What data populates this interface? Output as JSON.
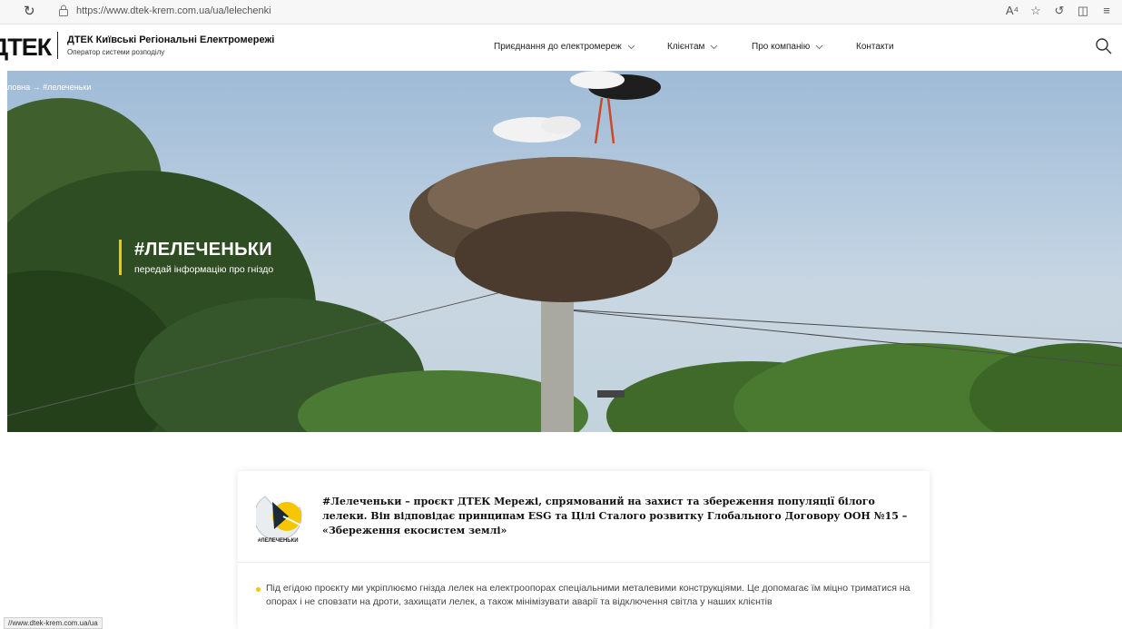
{
  "browser": {
    "url": "https://www.dtek-krem.com.ua/ua/lelechenki",
    "status_url": "//www.dtek-krem.com.ua/ua"
  },
  "header": {
    "logo_text": "ДТЕК",
    "brand_title": "ДТЕК Київські Регіональні Електромережі",
    "brand_subtitle": "Оператор системи розподілу",
    "nav": [
      {
        "label": "Приєднання до електромереж"
      },
      {
        "label": "Клієнтам"
      },
      {
        "label": "Про компанію"
      },
      {
        "label": "Контакти"
      }
    ]
  },
  "hero": {
    "breadcrumb": "ловна → #лелеченьки",
    "title": "#ЛЕЛЕЧЕНЬКИ",
    "subtitle": "передай інформацію про гніздо"
  },
  "card": {
    "logo_label": "#ЛЕЛЕЧЕНЬКИ",
    "intro": "#Лелеченьки – проєкт ДТЕК Мережі, спрямований на захист та збереження популяції білого лелеки. Він відповідає принципам ESG та Цілі Сталого розвитку Глобального Договору ООН №15 – «Збереження екосистем землі»",
    "bullet": "Під егідою проєкту ми укріплюємо гнізда лелек на електроопорах спеціальними металевими конструкціями. Це допомагає їм міцно триматися на опорах і не сповзати на дроти, захищати лелек, а також мінімізувати аварії та відключення світла у наших клієнтів"
  },
  "colors": {
    "accent": "#f7c600"
  }
}
